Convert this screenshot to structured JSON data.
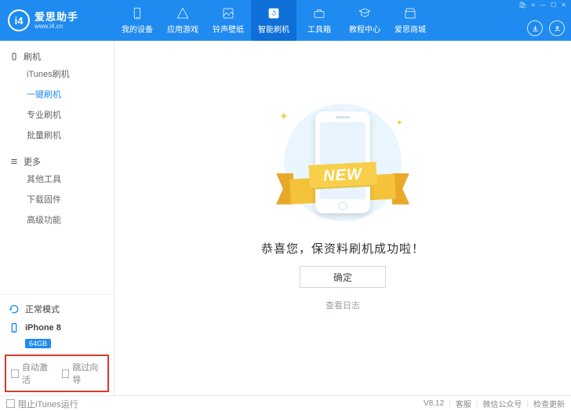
{
  "brand": {
    "name": "爱思助手",
    "url": "www.i4.cn",
    "logo": "i4"
  },
  "topTabs": [
    {
      "label": "我的设备"
    },
    {
      "label": "应用游戏"
    },
    {
      "label": "铃声壁纸"
    },
    {
      "label": "智能刷机",
      "active": true
    },
    {
      "label": "工具箱"
    },
    {
      "label": "教程中心"
    },
    {
      "label": "爱思商城"
    }
  ],
  "sidebar": {
    "g1": {
      "title": "刷机",
      "items": [
        "iTunes刷机",
        "一键刷机",
        "专业刷机",
        "批量刷机"
      ],
      "activeIndex": 1
    },
    "g2": {
      "title": "更多",
      "items": [
        "其他工具",
        "下载固件",
        "高级功能"
      ]
    }
  },
  "mode": "正常模式",
  "device": {
    "name": "iPhone 8",
    "storage": "64GB"
  },
  "options": {
    "autoActivate": "自动激活",
    "skipGuide": "跳过向导"
  },
  "main": {
    "ribbon": "NEW",
    "message": "恭喜您，保资料刷机成功啦！",
    "ok": "确定",
    "log": "查看日志"
  },
  "status": {
    "blockItunes": "阻止iTunes运行",
    "version": "V8.12",
    "links": [
      "客服",
      "微信公众号",
      "检查更新"
    ]
  }
}
